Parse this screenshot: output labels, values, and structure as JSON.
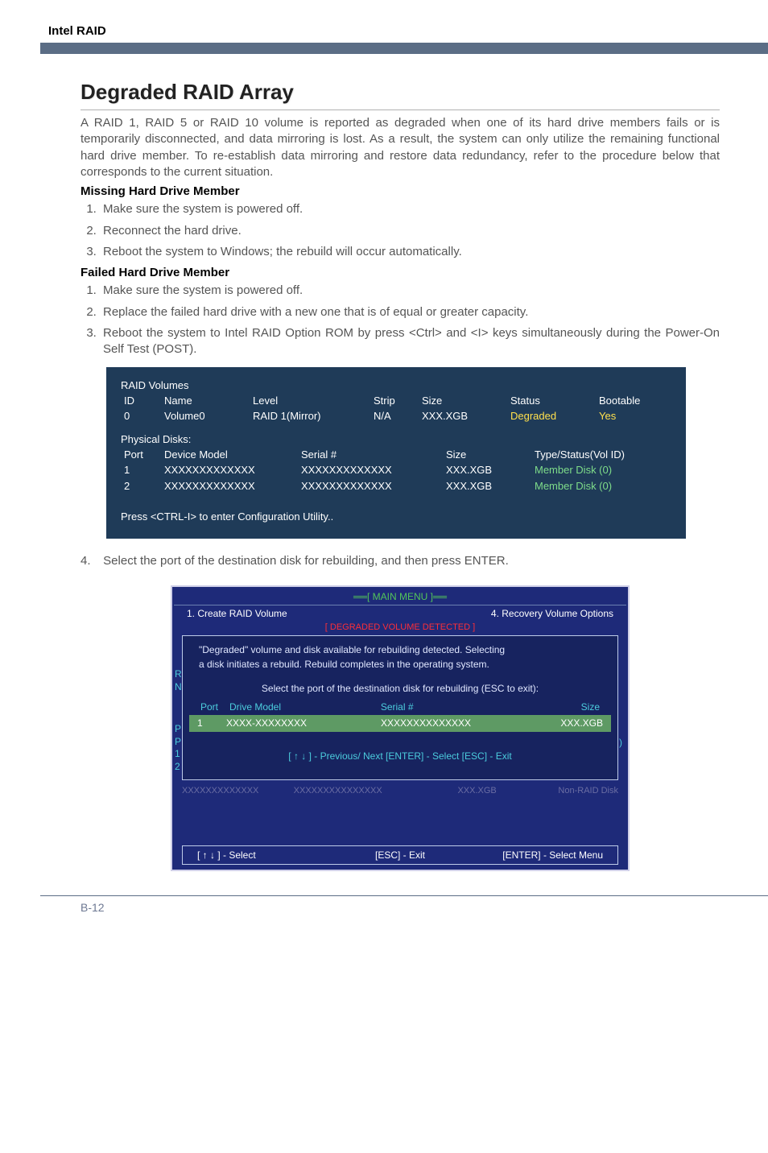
{
  "header": {
    "title": "Intel RAID"
  },
  "section": {
    "title": "Degraded RAID Array",
    "intro": "A RAID 1, RAID 5 or RAID 10 volume is reported as degraded when one of its hard drive members fails or is temporarily disconnected, and data mirroring is lost. As a result, the system can only utilize the remaining functional hard drive member. To re-establish data mirroring and restore data redundancy, refer to the procedure below that corresponds to the current situation.",
    "missing_head": "Missing Hard Drive Member",
    "missing_steps": [
      "Make sure the system is powered off.",
      "Reconnect the hard drive.",
      "Reboot the system to Windows; the rebuild will occur automatically."
    ],
    "failed_head": "Failed Hard Drive Member",
    "failed_steps": [
      "Make sure the system is powered off.",
      "Replace the failed hard drive with a new one that is of equal or greater capacity.",
      "Reboot the system to Intel RAID Option ROM by press <Ctrl> and <I> keys simultaneously during the Power-On Self Test (POST)."
    ],
    "step4": "Select the port of the destination disk for rebuilding, and then press ENTER."
  },
  "bios1": {
    "vol_head": "RAID Volumes",
    "cols": {
      "id": "ID",
      "name": "Name",
      "level": "Level",
      "strip": "Strip",
      "size": "Size",
      "status": "Status",
      "boot": "Bootable"
    },
    "row": {
      "id": "0",
      "name": "Volume0",
      "level": "RAID 1(Mirror)",
      "strip": "N/A",
      "size": "XXX.XGB",
      "status": "Degraded",
      "boot": "Yes"
    },
    "phys_head": "Physical Disks:",
    "pcols": {
      "port": "Port",
      "model": "Device Model",
      "serial": "Serial #",
      "size": "Size",
      "type": "Type/Status(Vol ID)"
    },
    "prow1": {
      "port": "1",
      "model": "XXXXXXXXXXXXX",
      "serial": "XXXXXXXXXXXXX",
      "size": "XXX.XGB",
      "type": "Member  Disk (0)"
    },
    "prow2": {
      "port": "2",
      "model": "XXXXXXXXXXXXX",
      "serial": "XXXXXXXXXXXXX",
      "size": "XXX.XGB",
      "type": "Member  Disk (0)"
    },
    "prompt": "Press  <CTRL-I>  to enter Configuration Utility.."
  },
  "rom": {
    "main_menu": "MAIN  MENU",
    "menu_left": "1.       Create  RAID  Volume",
    "menu_right": "4.       Recovery Volume  Options",
    "degraded": "[  DEGRADED VOLUME DETECTED  ]",
    "line1": "\"Degraded\" volume and disk available for rebuilding detected. Selecting",
    "line2": "a disk initiates a rebuild. Rebuild completes in the  operating system.",
    "line3": "Select the port of the destination disk for rebuilding (ESC to exit):",
    "hcols": {
      "port": "Port",
      "model": "Drive   Model",
      "serial": "Serial  #",
      "size": "Size"
    },
    "hrow": {
      "port": "1",
      "model": "XXXX-XXXXXXXX",
      "serial": "XXXXXXXXXXXXXX",
      "size": "XXX.XGB"
    },
    "nav": "[ ↑ ↓ ] - Previous/ Next      [ENTER] - Select      [ESC] - Exit",
    "ghost": {
      "g1": "XXXXXXXXXXXXX",
      "g2": "XXXXXXXXXXXXXXX",
      "g3": "XXX.XGB",
      "g4": "Non-RAID  Disk"
    },
    "footer": {
      "f1": "[ ↑ ↓ ] - Select",
      "f2": "[ESC] - Exit",
      "f3": "[ENTER] - Select Menu"
    }
  },
  "page_num": "B-12"
}
